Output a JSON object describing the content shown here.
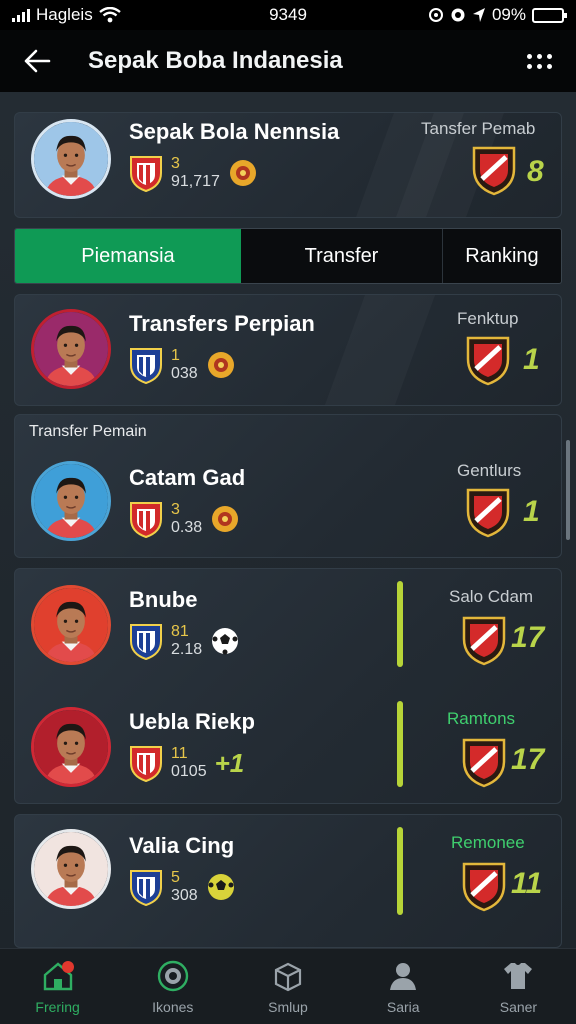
{
  "status_bar": {
    "carrier": "Hagleis",
    "time": "9349",
    "battery": "09%"
  },
  "app_bar": {
    "title": "Sepak Boba Indanesia"
  },
  "header_card": {
    "name": "Sepak Bola Nennsia",
    "num_top": "3",
    "num_bottom": "91,717",
    "right_label": "Tansfer Pemab",
    "right_value": "8"
  },
  "tabs": [
    "Piemansia",
    "Transfer",
    "Ranking"
  ],
  "card_transfers": {
    "name": "Transfers Perpian",
    "num_top": "1",
    "num_bottom": "038",
    "right_label": "Fenktup",
    "right_value": "1"
  },
  "section": {
    "label": "Transfer Pemain"
  },
  "card_calam": {
    "name": "Catam Gad",
    "num_top": "3",
    "num_bottom": "0.38",
    "right_label": "Gentlurs",
    "right_value": "1"
  },
  "list": [
    {
      "name": "Bnube",
      "num_top": "81",
      "num_bottom": "2.18",
      "right_label": "Salo Cdam",
      "right_value": "17"
    },
    {
      "name": "Uebla Riekp",
      "num_top": "11",
      "num_bottom": "0105",
      "extra": "+1",
      "right_label": "Ramtons",
      "right_value": "17"
    },
    {
      "name": "Valia Cing",
      "num_top": "5",
      "num_bottom": "308",
      "right_label": "Remonee",
      "right_value": "11"
    }
  ],
  "bottom_nav": [
    {
      "label": "Frering",
      "icon": "home-icon"
    },
    {
      "label": "Ikones",
      "icon": "club-badge-icon"
    },
    {
      "label": "Smlup",
      "icon": "box-icon"
    },
    {
      "label": "Saria",
      "icon": "user-icon"
    },
    {
      "label": "Saner",
      "icon": "jersey-icon"
    }
  ],
  "colors": {
    "accent": "#0f9a55",
    "highlight": "#b9d44a",
    "background": "#1e252b"
  }
}
